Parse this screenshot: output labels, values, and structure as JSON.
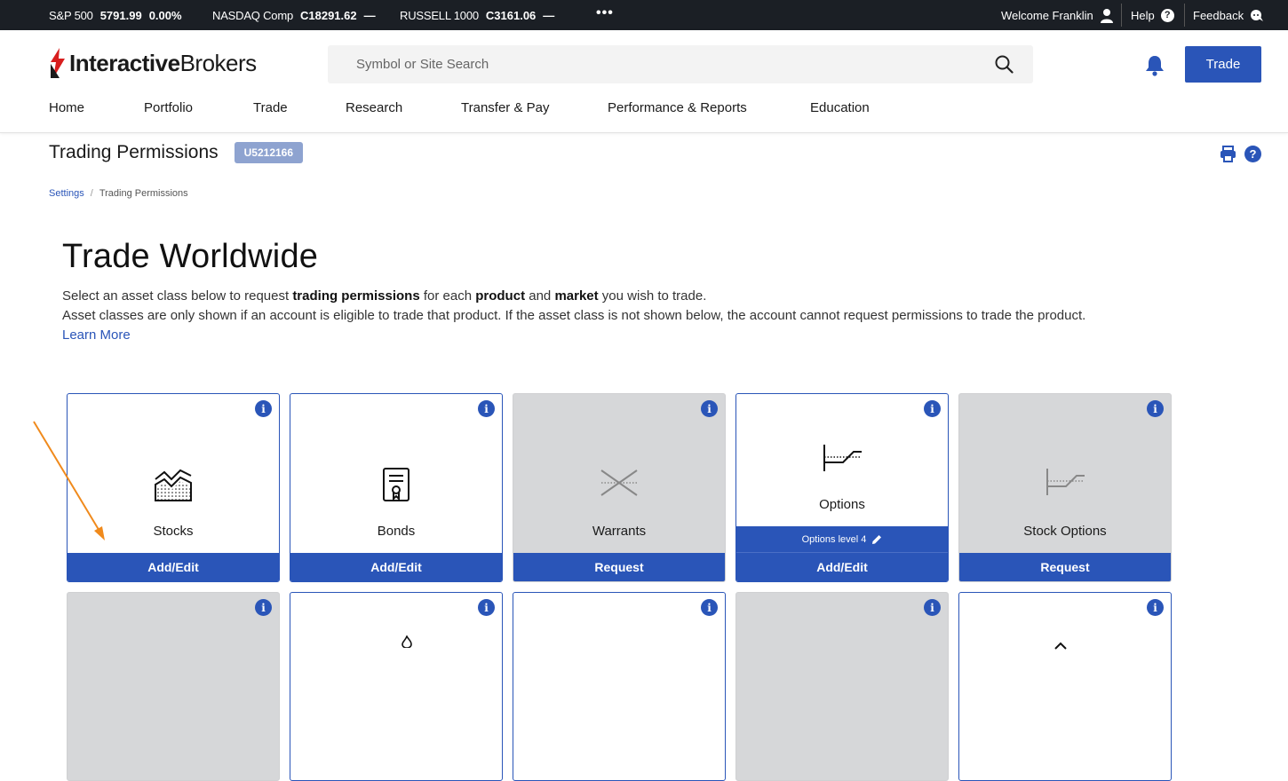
{
  "ticker": {
    "items": [
      {
        "name": "S&P 500",
        "price": "5791.99",
        "change": "0.00%"
      },
      {
        "name": "NASDAQ Comp",
        "price": "C18291.62",
        "change": "—"
      },
      {
        "name": "RUSSELL 1000",
        "price": "C3161.06",
        "change": "—"
      }
    ],
    "more": "•••",
    "welcome": "Welcome Franklin",
    "help": "Help",
    "feedback": "Feedback"
  },
  "header": {
    "logo_bold": "Interactive",
    "logo_regular": "Brokers",
    "search_placeholder": "Symbol or Site Search",
    "trade_button": "Trade",
    "nav": [
      "Home",
      "Portfolio",
      "Trade",
      "Research",
      "Transfer & Pay",
      "Performance & Reports",
      "Education"
    ]
  },
  "page": {
    "title": "Trading Permissions",
    "account": "U5212166",
    "breadcrumb": [
      "Settings",
      "Trading Permissions"
    ]
  },
  "hero": {
    "heading": "Trade Worldwide",
    "line1_a": "Select an asset class below to request ",
    "line1_b": "trading permissions",
    "line1_c": " for each ",
    "line1_d": "product",
    "line1_e": " and ",
    "line1_f": "market",
    "line1_g": " you wish to trade.",
    "line2": "Asset classes are only shown if an account is eligible to trade that product. If the asset class is not shown below, the account cannot request permissions to trade the product.",
    "learn_more": "Learn More"
  },
  "cards": [
    {
      "label": "Stocks",
      "action": "Add/Edit",
      "icon": "stocks-chart-icon",
      "enabled": true
    },
    {
      "label": "Bonds",
      "action": "Add/Edit",
      "icon": "bond-certificate-icon",
      "enabled": true
    },
    {
      "label": "Warrants",
      "action": "Request",
      "icon": "warrants-cross-icon",
      "enabled": false
    },
    {
      "label": "Options",
      "action": "Add/Edit",
      "icon": "options-payoff-icon",
      "enabled": true,
      "level": "Options level 4"
    },
    {
      "label": "Stock Options",
      "action": "Request",
      "icon": "stock-options-payoff-icon",
      "enabled": false
    }
  ],
  "colors": {
    "brand_blue": "#2a55b8",
    "ticker_bg": "#1b1f25",
    "disabled_card": "#d6d7d9",
    "annotation_arrow": "#f08a1c"
  }
}
